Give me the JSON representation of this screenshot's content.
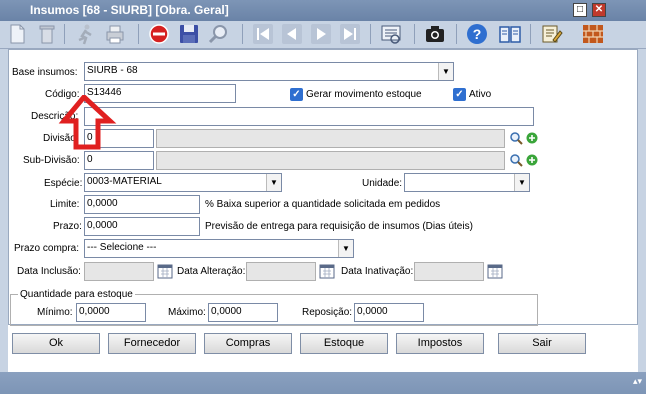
{
  "window": {
    "title": "Insumos [68 - SIURB] [Obra. Geral]",
    "maximize_glyph": "□",
    "close_glyph": "✕"
  },
  "toolbar": {
    "icons": [
      "new-document-icon",
      "delete-icon",
      "run-icon",
      "print-icon",
      "cancel-icon",
      "save-icon",
      "search-icon",
      "first-icon",
      "previous-icon",
      "next-icon",
      "last-icon",
      "report-icon",
      "camera-icon",
      "help-icon",
      "book-icon",
      "edit-list-icon",
      "wall-icon"
    ]
  },
  "form": {
    "base_insumos": {
      "label": "Base insumos:",
      "value": "SIURB - 68"
    },
    "codigo": {
      "label": "Código:",
      "value": "S13446"
    },
    "gerar_movimento": {
      "label": "Gerar movimento estoque",
      "checked": true
    },
    "ativo": {
      "label": "Ativo",
      "checked": true
    },
    "descricao": {
      "label": "Descrição:",
      "value": ""
    },
    "divisao": {
      "label": "Divisão:",
      "value": "0",
      "desc": ""
    },
    "sub_divisao": {
      "label": "Sub-Divisão:",
      "value": "0",
      "desc": ""
    },
    "especie": {
      "label": "Espécie:",
      "value": "0003-MATERIAL"
    },
    "unidade": {
      "label": "Unidade:",
      "value": ""
    },
    "limite": {
      "label": "Limite:",
      "value": "0,0000",
      "hint": "% Baixa superior a quantidade solicitada em pedidos"
    },
    "prazo": {
      "label": "Prazo:",
      "value": "0,0000",
      "hint": "Previsão de entrega para requisição de insumos (Dias úteis)"
    },
    "prazo_compra": {
      "label": "Prazo compra:",
      "value": "--- Selecione ---"
    },
    "data_inclusao": {
      "label": "Data Inclusão:",
      "value": ""
    },
    "data_alteracao": {
      "label": "Data Alteração:",
      "value": ""
    },
    "data_inativacao": {
      "label": "Data Inativação:",
      "value": ""
    },
    "quantidade": {
      "legend": "Quantidade para estoque",
      "minimo": {
        "label": "Mínimo:",
        "value": "0,0000"
      },
      "maximo": {
        "label": "Máximo:",
        "value": "0,0000"
      },
      "reposicao": {
        "label": "Reposição:",
        "value": "0,0000"
      }
    }
  },
  "buttons": {
    "ok": "Ok",
    "fornecedor": "Fornecedor",
    "compras": "Compras",
    "estoque": "Estoque",
    "impostos": "Impostos",
    "sair": "Sair"
  },
  "colors": {
    "titlebar": "#7d95b6",
    "toolbar": "#c7d3e3",
    "arrow": "#e02020",
    "checkbox": "#2f6fd0"
  }
}
